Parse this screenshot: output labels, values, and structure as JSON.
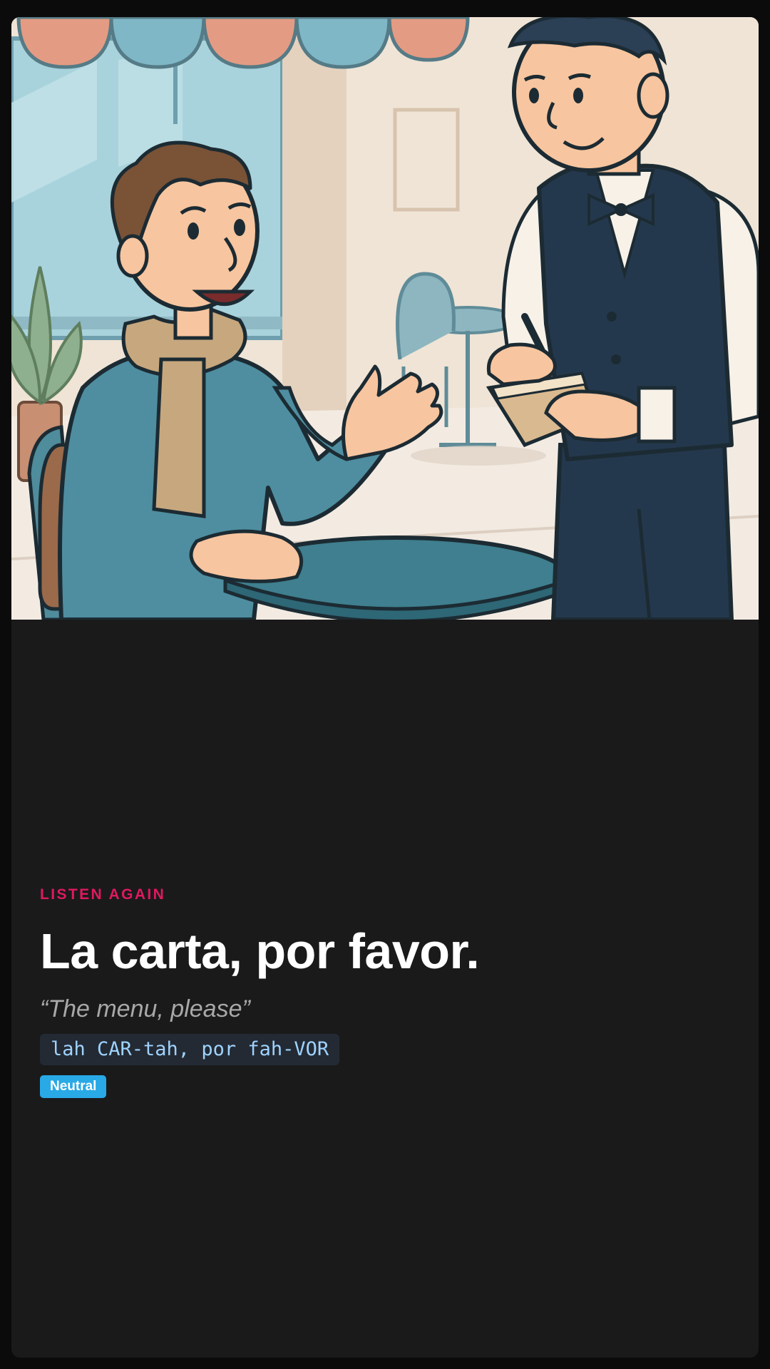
{
  "lesson_card": {
    "eyebrow": "LISTEN AGAIN",
    "phrase": "La carta, por favor.",
    "translation": "“The menu, please”",
    "pronunciation": "lah CAR-tah, por fah-VOR",
    "tone_badge": "Neutral"
  },
  "illustration": {
    "icon": "cafe-ordering-illustration",
    "subject": "customer ordering from waiter"
  },
  "colors": {
    "accent": "#e0195e",
    "badge": "#29a9e6",
    "card_background": "#1a1a1b",
    "pronunciation_text": "#9fd3ff"
  }
}
